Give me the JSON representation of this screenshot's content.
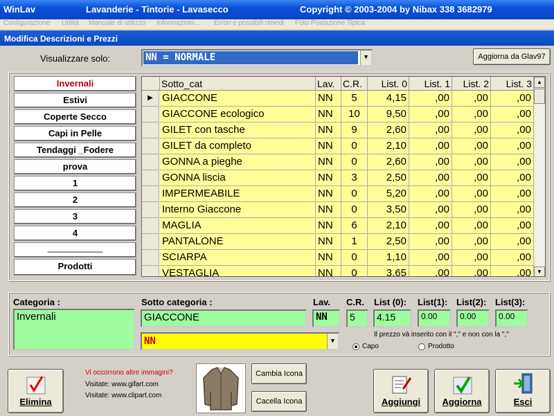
{
  "window": {
    "app_name": "WinLav",
    "app_title": "Lavanderie - Tintorie - Lavasecco",
    "copyright": "Copyright © 2003-2004  by Nibax  338 3682979"
  },
  "menu": [
    "Configurazione",
    "Utilità",
    "Manuale di utilizzo",
    "Informazioni...",
    "Errori e possibili rimedi",
    "Foto Postazione Tipica"
  ],
  "form_title": "Modifica Descrizioni e Prezzi",
  "filter": {
    "label": "Visualizzare solo:",
    "value": "NN  =  NORMALE",
    "update_button": "Aggiorna da Glav97"
  },
  "categories": [
    "Invernali",
    "Estivi",
    "Coperte Secco",
    "Capi in Pelle",
    "Tendaggi _Fodere",
    "prova",
    "1",
    "2",
    "3",
    "4",
    "___________",
    "Prodotti"
  ],
  "grid": {
    "headers": [
      "Sotto_cat",
      "Lav.",
      "C.R.",
      "List. 0",
      "List. 1",
      "List. 2",
      "List. 3"
    ],
    "rows": [
      [
        "GIACCONE",
        "NN",
        "5",
        "4,15",
        ",00",
        ",00",
        ",00"
      ],
      [
        "GIACCONE ecologico",
        "NN",
        "10",
        "9,50",
        ",00",
        ",00",
        ",00"
      ],
      [
        "GILET con tasche",
        "NN",
        "9",
        "2,60",
        ",00",
        ",00",
        ",00"
      ],
      [
        "GILET da completo",
        "NN",
        "0",
        "2,10",
        ",00",
        ",00",
        ",00"
      ],
      [
        "GONNA a pieghe",
        "NN",
        "0",
        "2,60",
        ",00",
        ",00",
        ",00"
      ],
      [
        "GONNA liscia",
        "NN",
        "3",
        "2,50",
        ",00",
        ",00",
        ",00"
      ],
      [
        "IMPERMEABILE",
        "NN",
        "0",
        "5,20",
        ",00",
        ",00",
        ",00"
      ],
      [
        "Interno Giaccone",
        "NN",
        "0",
        "3,50",
        ",00",
        ",00",
        ",00"
      ],
      [
        "MAGLIA",
        "NN",
        "6",
        "2,10",
        ",00",
        ",00",
        ",00"
      ],
      [
        "PANTALONE",
        "NN",
        "1",
        "2,50",
        ",00",
        ",00",
        ",00"
      ],
      [
        "SCIARPA",
        "NN",
        "0",
        "1,10",
        ",00",
        ",00",
        ",00"
      ],
      [
        "VESTAGLIA",
        "NN",
        "0",
        "3,65",
        ",00",
        ",00",
        ",00"
      ]
    ]
  },
  "details": {
    "categoria_label": "Categoria :",
    "categoria_value": "Invernali",
    "sotto_label": "Sotto categoria :",
    "sotto_value": "GIACCONE",
    "lav_label": "Lav.",
    "lav_value": "NN",
    "cr_label": "C.R.",
    "cr_value": "5",
    "list0_label": "List (0):",
    "list0_value": "4.15",
    "list1_label": "List(1):",
    "list1_value": "0.00",
    "list2_label": "List(2):",
    "list2_value": "0.00",
    "list3_label": "List(3):",
    "list3_value": "0.00",
    "lav_combo": "NN",
    "price_note": "Il prezzo và inserito con il  \",\"  e non con la \",\"",
    "radio_capo": "Capo",
    "radio_prodotto": "Prodotto"
  },
  "bottom": {
    "elimina": "Elimina",
    "need_images": "Vi occorrono altre immagini?",
    "visit1": "Visitate: www.gifart.com",
    "visit2": "Visitate: www.clipart.com",
    "cambia_icona": "Cambia Icona",
    "cancella_icona": "Cacella Icona",
    "aggiungi": "Aggiungi",
    "aggiorna": "Aggiorna",
    "esci": "Esci"
  },
  "colors": {
    "grid_cell": "#fffe99",
    "field_green": "#9efc9e",
    "combo_yellow": "#ffff00",
    "titlebar_blue": "#0a4fd8"
  }
}
